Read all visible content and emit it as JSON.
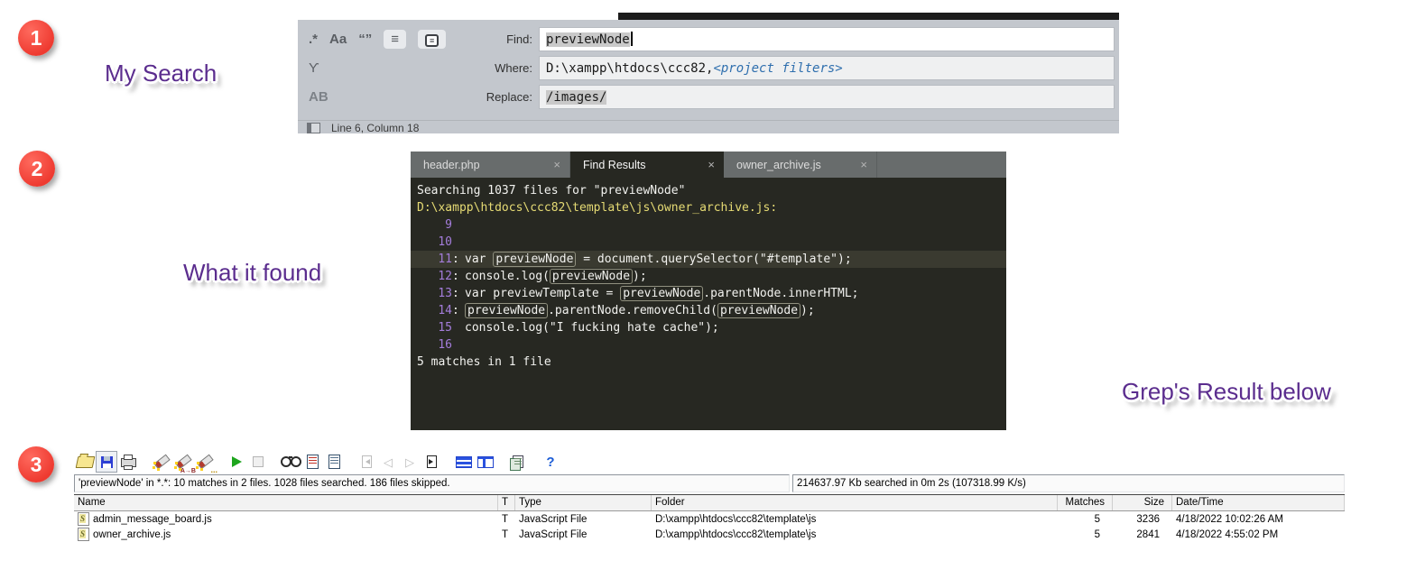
{
  "annotations": {
    "badge1": "1",
    "badge2": "2",
    "badge3": "3",
    "labels": {
      "search": "My Search",
      "found": "What it found",
      "grep": "Grep's Result below"
    }
  },
  "find_panel": {
    "toggles": {
      "regex": ".*",
      "case_sensitive": "Aa",
      "whole_word": "“”",
      "wrap": "≡",
      "context": "≡",
      "use_buffer": "ϒ",
      "preserve_case": "AB"
    },
    "find": {
      "label": "Find:",
      "value": "previewNode"
    },
    "where": {
      "label": "Where:",
      "value": "D:\\xampp\\htdocs\\ccc82,",
      "hint": "<project filters>"
    },
    "replace": {
      "label": "Replace:",
      "value": "/images/"
    },
    "status": "Line 6, Column 18"
  },
  "editor": {
    "tabs": [
      {
        "label": "header.php",
        "active": false
      },
      {
        "label": "Find Results",
        "active": true
      },
      {
        "label": "owner_archive.js",
        "active": false
      }
    ],
    "close_glyph": "×",
    "lines": [
      {
        "text": "Searching 1037 files for \"previewNode\""
      },
      {
        "text": ""
      },
      {
        "text": "D:\\xampp\\htdocs\\ccc82\\template\\js\\owner_archive.js:",
        "cls": "path"
      },
      {
        "num": "9",
        "sep": ""
      },
      {
        "num": "10",
        "sep": ""
      },
      {
        "num": "11",
        "sep": ":",
        "highlight": true,
        "segs": [
          {
            "t": "var "
          },
          {
            "m": "previewNode"
          },
          {
            "t": " = document.querySelector(\"#template\");"
          }
        ]
      },
      {
        "num": "12",
        "sep": ":",
        "segs": [
          {
            "t": "console.log("
          },
          {
            "m": "previewNode"
          },
          {
            "t": ");"
          }
        ]
      },
      {
        "num": "13",
        "sep": ":",
        "segs": [
          {
            "t": "var previewTemplate = "
          },
          {
            "m": "previewNode"
          },
          {
            "t": ".parentNode.innerHTML;"
          }
        ]
      },
      {
        "num": "14",
        "sep": ":",
        "segs": [
          {
            "m": "previewNode"
          },
          {
            "t": ".parentNode.removeChild("
          },
          {
            "m": "previewNode"
          },
          {
            "t": ");"
          }
        ]
      },
      {
        "num": "15",
        "sep": "",
        "segs": [
          {
            "t": "console.log(\"I fucking hate cache\");"
          }
        ]
      },
      {
        "num": "16",
        "sep": ""
      },
      {
        "text": ""
      },
      {
        "text": "5 matches in 1 file"
      }
    ]
  },
  "grep": {
    "toolbar": [
      {
        "name": "open-folder",
        "group": 0
      },
      {
        "name": "save",
        "group": 0,
        "state": "pressed"
      },
      {
        "name": "print",
        "group": 0
      },
      {
        "name": "search",
        "group": 1
      },
      {
        "name": "search-replace",
        "group": 1,
        "sub": "A→B"
      },
      {
        "name": "search-options",
        "group": 1,
        "sub": "..."
      },
      {
        "name": "run-search",
        "group": 2
      },
      {
        "name": "stop-search",
        "group": 2,
        "state": "disabled"
      },
      {
        "name": "view-matches",
        "group": 3
      },
      {
        "name": "match-report",
        "group": 3
      },
      {
        "name": "file-report",
        "group": 3
      },
      {
        "name": "first-match",
        "group": 4,
        "state": "disabled"
      },
      {
        "name": "prev-match",
        "group": 4,
        "state": "disabled",
        "glyph": "◁"
      },
      {
        "name": "next-match",
        "group": 4,
        "state": "disabled",
        "glyph": "▷"
      },
      {
        "name": "last-match",
        "group": 4
      },
      {
        "name": "split-horizontal",
        "group": 5
      },
      {
        "name": "split-vertical",
        "group": 5
      },
      {
        "name": "copy-results",
        "group": 6
      },
      {
        "name": "help",
        "group": 7,
        "glyph": "?"
      }
    ],
    "status_left": "'previewNode' in *.*: 10 matches in 2 files. 1028 files searched. 186 files skipped.",
    "status_right": "214637.97 Kb searched in 0m 2s (107318.99 K/s)",
    "columns": [
      "Name",
      "T",
      "Type",
      "Folder",
      "Matches",
      "Size",
      "Date/Time"
    ],
    "rows": [
      {
        "name": "admin_message_board.js",
        "t": "T",
        "type": "JavaScript File",
        "folder": "D:\\xampp\\htdocs\\ccc82\\template\\js",
        "matches": "5",
        "size": "3236",
        "datetime": "4/18/2022 10:02:26 AM"
      },
      {
        "name": "owner_archive.js",
        "t": "T",
        "type": "JavaScript File",
        "folder": "D:\\xampp\\htdocs\\ccc82\\template\\js",
        "matches": "5",
        "size": "2841",
        "datetime": "4/18/2022 4:55:02 PM"
      }
    ]
  }
}
